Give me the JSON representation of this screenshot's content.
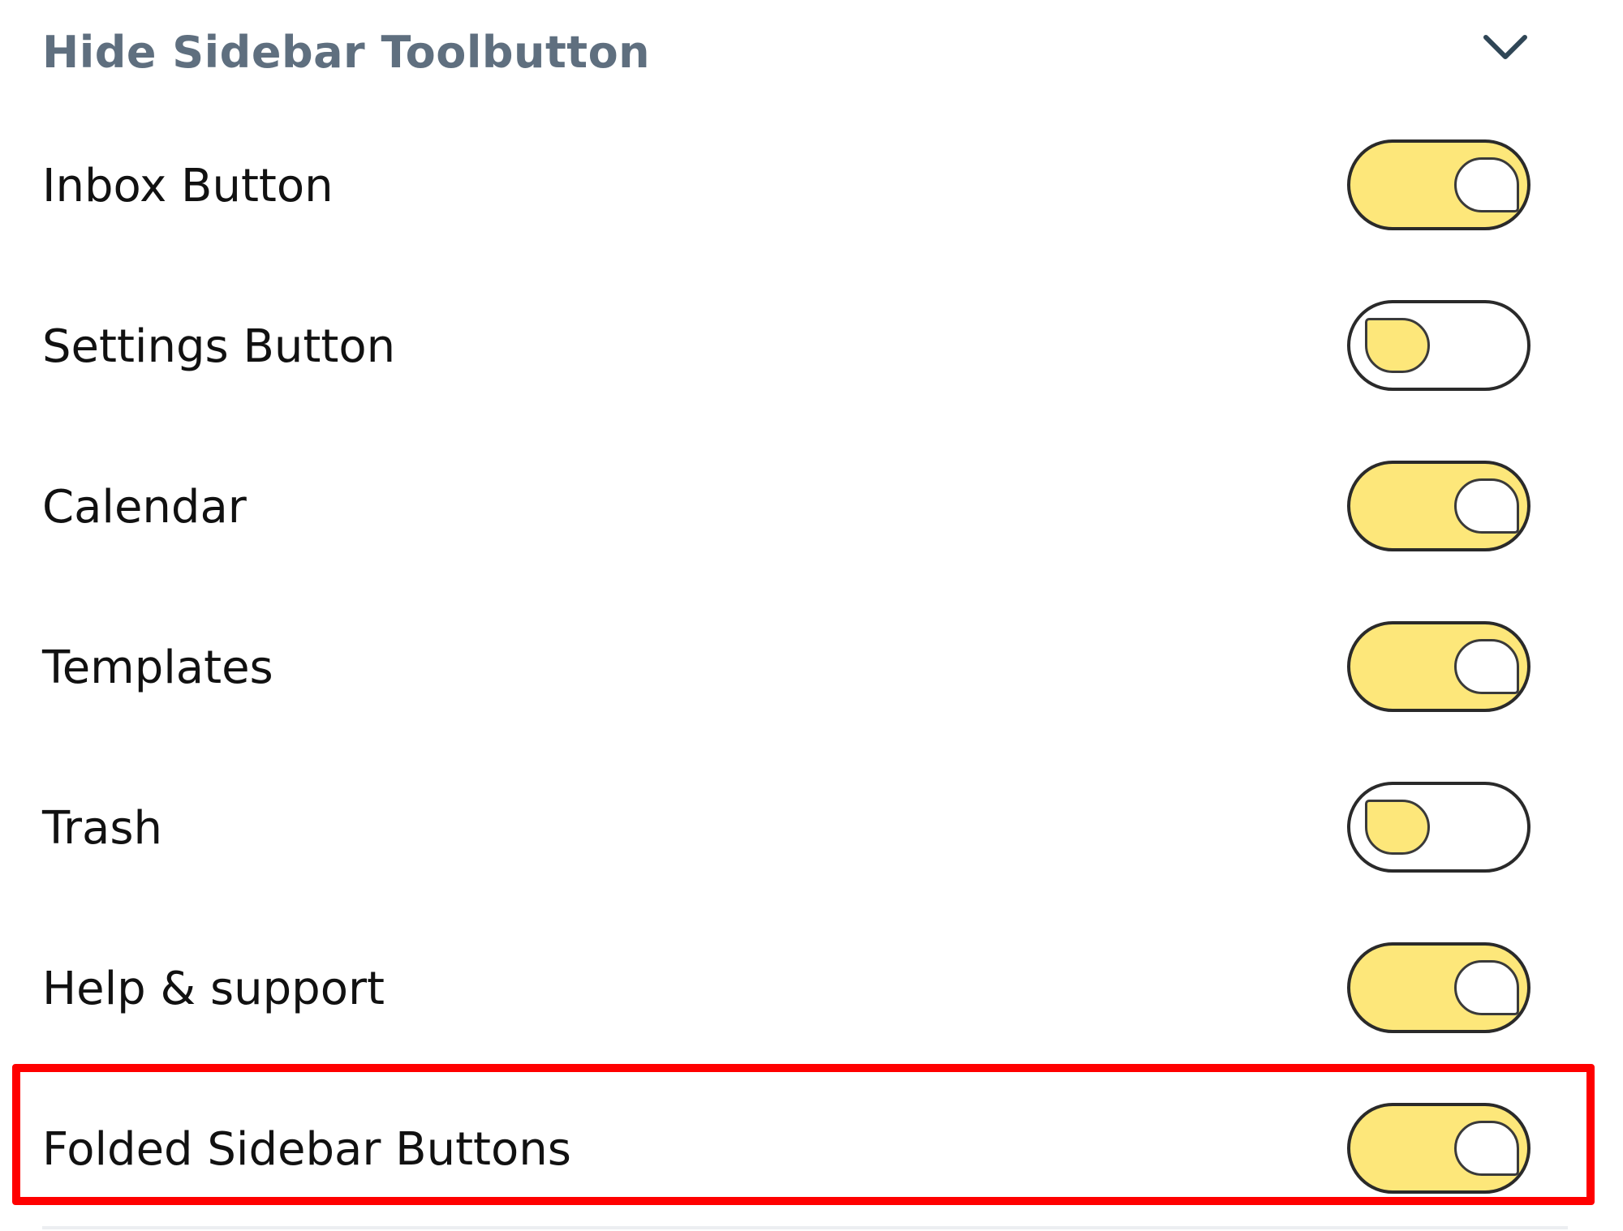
{
  "section": {
    "title": "Hide Sidebar Toolbutton",
    "collapse_icon": "chevron-down-icon",
    "expanded": true
  },
  "theme": {
    "toggle_on_color": "#fde77a",
    "toggle_border_color": "#2a2a2a",
    "title_color": "#5f6f7f",
    "highlight_color": "#ff0000"
  },
  "settings": [
    {
      "label": "Inbox Button",
      "enabled": true
    },
    {
      "label": "Settings Button",
      "enabled": false
    },
    {
      "label": "Calendar",
      "enabled": true
    },
    {
      "label": "Templates",
      "enabled": true
    },
    {
      "label": "Trash",
      "enabled": false
    },
    {
      "label": "Help & support",
      "enabled": true
    },
    {
      "label": "Folded Sidebar Buttons",
      "enabled": true,
      "highlighted": true
    }
  ]
}
